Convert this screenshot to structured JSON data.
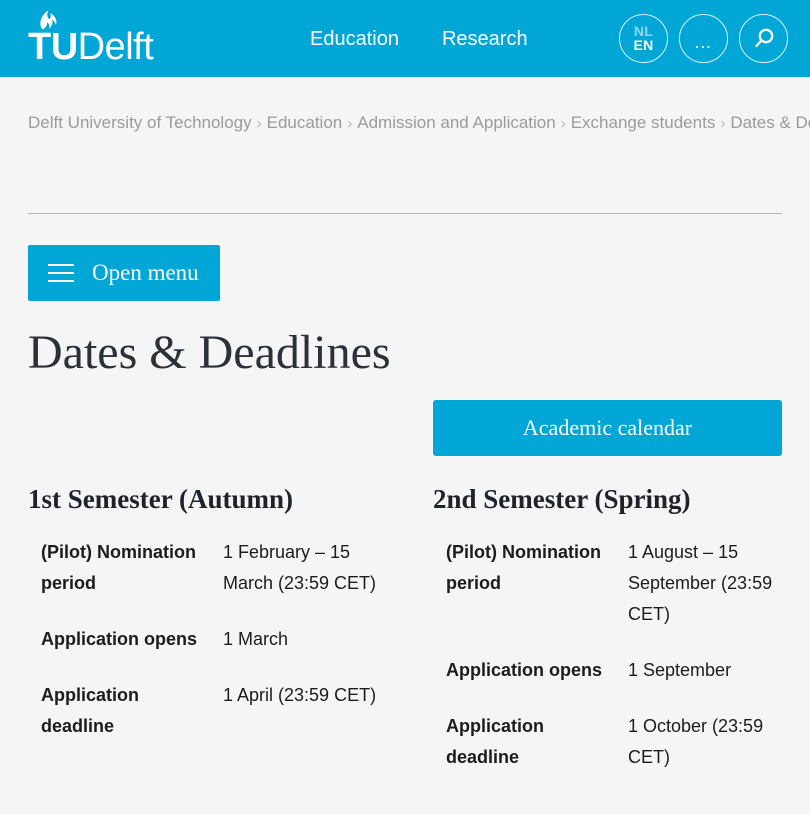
{
  "header": {
    "logo": {
      "icon": "tudelft-flame-icon",
      "tu": "TU",
      "delft": "Delft"
    },
    "nav": [
      {
        "label": "Education"
      },
      {
        "label": "Research"
      }
    ],
    "actions": {
      "language": {
        "inactive": "NL",
        "active": "EN"
      },
      "more": {
        "label": "…",
        "icon": "ellipsis-icon"
      },
      "search": {
        "icon": "search-icon"
      }
    },
    "background_color": "#00a6d6"
  },
  "breadcrumb": {
    "separator": "›",
    "items": [
      {
        "label": "Delft University of Technology"
      },
      {
        "label": "Education"
      },
      {
        "label": "Admission and Application"
      },
      {
        "label": "Exchange students"
      },
      {
        "label": "Dates & Deadlines"
      }
    ]
  },
  "menu_button": {
    "label": "Open menu",
    "icon": "hamburger-icon"
  },
  "main": {
    "title": "Dates & Deadlines",
    "calendar_button": {
      "label": "Academic calendar"
    },
    "semesters": [
      {
        "heading": "1st Semester (Autumn)",
        "rows": [
          {
            "label": "(Pilot) Nomination period",
            "value": "1 February – 15 March (23:59 CET)"
          },
          {
            "label": "Application opens",
            "value": "1 March"
          },
          {
            "label": "Application deadline",
            "value": "1 April (23:59 CET)"
          }
        ]
      },
      {
        "heading": "2nd Semester (Spring)",
        "rows": [
          {
            "label": "(Pilot) Nomination period",
            "value": "1 August – 15 September (23:59 CET)"
          },
          {
            "label": "Application opens",
            "value": "1 September"
          },
          {
            "label": "Application deadline",
            "value": "1 October (23:59 CET)"
          }
        ]
      }
    ]
  },
  "colors": {
    "brand_blue": "#00a6d6",
    "page_background": "#f5f5f5",
    "title_text": "#2b3039",
    "breadcrumb_text": "#9b9b9b"
  }
}
